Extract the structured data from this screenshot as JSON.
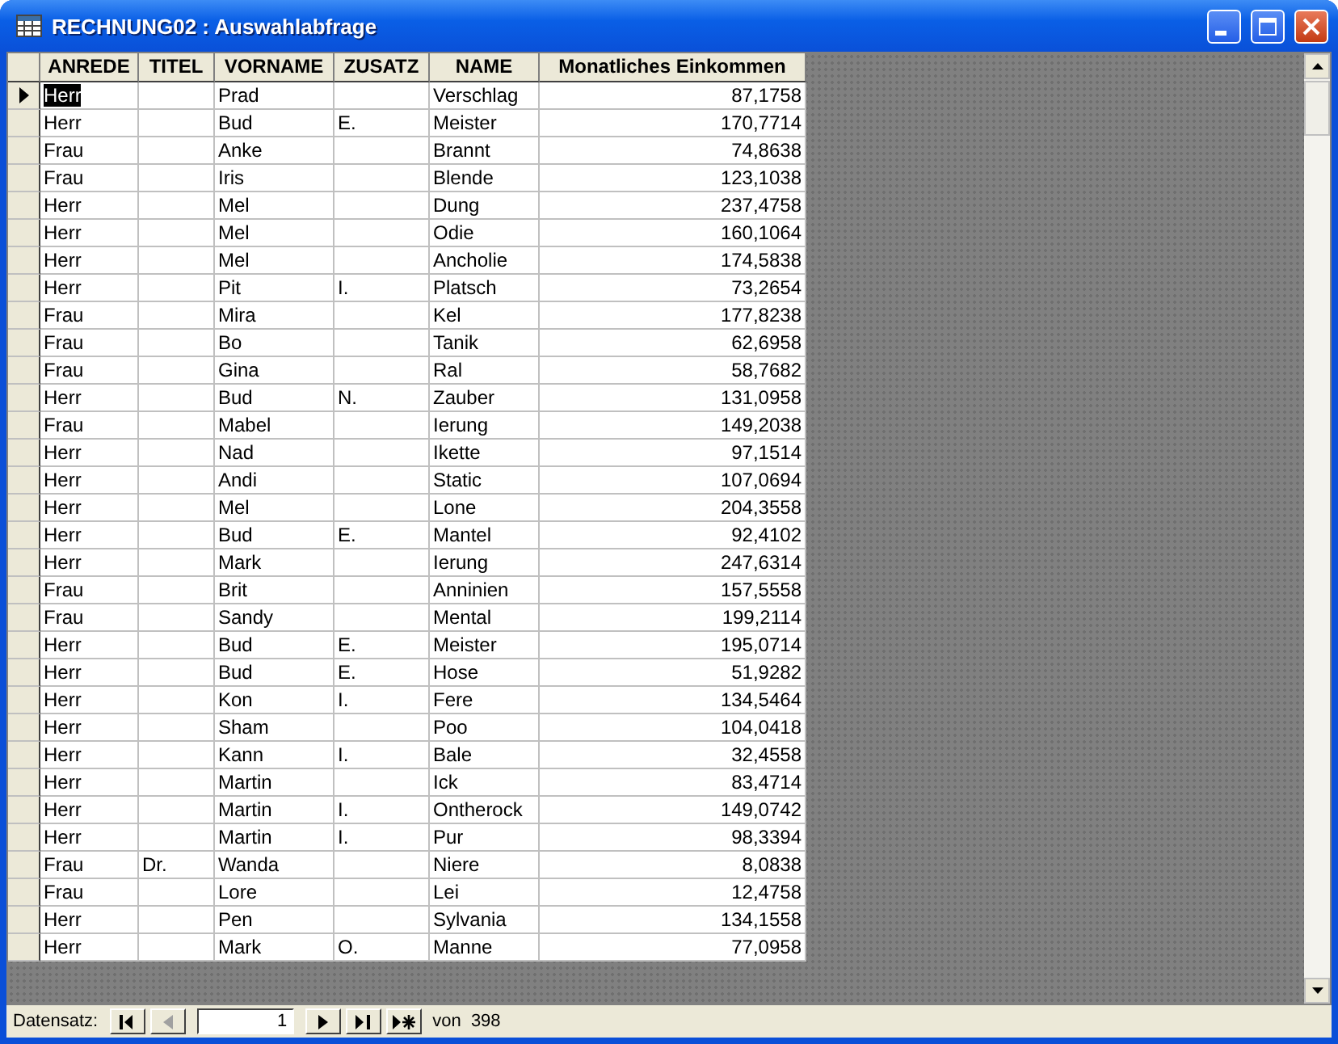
{
  "window": {
    "title": "RECHNUNG02 : Auswahlabfrage"
  },
  "table": {
    "columns": [
      {
        "label": "ANREDE",
        "kind": "text"
      },
      {
        "label": "TITEL",
        "kind": "text"
      },
      {
        "label": "VORNAME",
        "kind": "text"
      },
      {
        "label": "ZUSATZ",
        "kind": "text"
      },
      {
        "label": "NAME",
        "kind": "text"
      },
      {
        "label": "Monatliches Einkommen",
        "kind": "number"
      }
    ],
    "rows": [
      {
        "selected": true,
        "cells": [
          "Herr",
          null,
          "Prad",
          null,
          "Verschlag",
          "87,1758"
        ]
      },
      {
        "selected": false,
        "cells": [
          "Herr",
          null,
          "Bud",
          "E.",
          "Meister",
          "170,7714"
        ]
      },
      {
        "selected": false,
        "cells": [
          "Frau",
          null,
          "Anke",
          null,
          "Brannt",
          "74,8638"
        ]
      },
      {
        "selected": false,
        "cells": [
          "Frau",
          null,
          "Iris",
          null,
          "Blende",
          "123,1038"
        ]
      },
      {
        "selected": false,
        "cells": [
          "Herr",
          null,
          "Mel",
          null,
          "Dung",
          "237,4758"
        ]
      },
      {
        "selected": false,
        "cells": [
          "Herr",
          null,
          "Mel",
          null,
          "Odie",
          "160,1064"
        ]
      },
      {
        "selected": false,
        "cells": [
          "Herr",
          null,
          "Mel",
          null,
          "Ancholie",
          "174,5838"
        ]
      },
      {
        "selected": false,
        "cells": [
          "Herr",
          null,
          "Pit",
          "I.",
          "Platsch",
          "73,2654"
        ]
      },
      {
        "selected": false,
        "cells": [
          "Frau",
          null,
          "Mira",
          null,
          "Kel",
          "177,8238"
        ]
      },
      {
        "selected": false,
        "cells": [
          "Frau",
          null,
          "Bo",
          null,
          "Tanik",
          "62,6958"
        ]
      },
      {
        "selected": false,
        "cells": [
          "Frau",
          null,
          "Gina",
          null,
          "Ral",
          "58,7682"
        ]
      },
      {
        "selected": false,
        "cells": [
          "Herr",
          null,
          "Bud",
          "N.",
          "Zauber",
          "131,0958"
        ]
      },
      {
        "selected": false,
        "cells": [
          "Frau",
          null,
          "Mabel",
          null,
          "Ierung",
          "149,2038"
        ]
      },
      {
        "selected": false,
        "cells": [
          "Herr",
          null,
          "Nad",
          null,
          "Ikette",
          "97,1514"
        ]
      },
      {
        "selected": false,
        "cells": [
          "Herr",
          null,
          "Andi",
          null,
          "Static",
          "107,0694"
        ]
      },
      {
        "selected": false,
        "cells": [
          "Herr",
          null,
          "Mel",
          null,
          "Lone",
          "204,3558"
        ]
      },
      {
        "selected": false,
        "cells": [
          "Herr",
          null,
          "Bud",
          "E.",
          "Mantel",
          "92,4102"
        ]
      },
      {
        "selected": false,
        "cells": [
          "Herr",
          null,
          "Mark",
          null,
          "Ierung",
          "247,6314"
        ]
      },
      {
        "selected": false,
        "cells": [
          "Frau",
          null,
          "Brit",
          null,
          "Anninien",
          "157,5558"
        ]
      },
      {
        "selected": false,
        "cells": [
          "Frau",
          null,
          "Sandy",
          null,
          "Mental",
          "199,2114"
        ]
      },
      {
        "selected": false,
        "cells": [
          "Herr",
          null,
          "Bud",
          "E.",
          "Meister",
          "195,0714"
        ]
      },
      {
        "selected": false,
        "cells": [
          "Herr",
          null,
          "Bud",
          "E.",
          "Hose",
          "51,9282"
        ]
      },
      {
        "selected": false,
        "cells": [
          "Herr",
          null,
          "Kon",
          "I.",
          "Fere",
          "134,5464"
        ]
      },
      {
        "selected": false,
        "cells": [
          "Herr",
          null,
          "Sham",
          null,
          "Poo",
          "104,0418"
        ]
      },
      {
        "selected": false,
        "cells": [
          "Herr",
          null,
          "Kann",
          "I.",
          "Bale",
          "32,4558"
        ]
      },
      {
        "selected": false,
        "cells": [
          "Herr",
          null,
          "Martin",
          null,
          "Ick",
          "83,4714"
        ]
      },
      {
        "selected": false,
        "cells": [
          "Herr",
          null,
          "Martin",
          "I.",
          "Ontherock",
          "149,0742"
        ]
      },
      {
        "selected": false,
        "cells": [
          "Herr",
          null,
          "Martin",
          "I.",
          "Pur",
          "98,3394"
        ]
      },
      {
        "selected": false,
        "cells": [
          "Frau",
          "Dr.",
          "Wanda",
          null,
          "Niere",
          "8,0838"
        ]
      },
      {
        "selected": false,
        "cells": [
          "Frau",
          null,
          "Lore",
          null,
          "Lei",
          "12,4758"
        ]
      },
      {
        "selected": false,
        "cells": [
          "Herr",
          null,
          "Pen",
          null,
          "Sylvania",
          "134,1558"
        ]
      },
      {
        "selected": false,
        "cells": [
          "Herr",
          null,
          "Mark",
          "O.",
          "Manne",
          "77,0958"
        ]
      }
    ]
  },
  "navigator": {
    "label": "Datensatz:",
    "buttons": [
      {
        "kind": "first",
        "disabled": false
      },
      {
        "kind": "prev",
        "disabled": true
      }
    ],
    "record": "1",
    "buttons_after": [
      {
        "kind": "next",
        "disabled": false
      },
      {
        "kind": "last",
        "disabled": false
      },
      {
        "kind": "new",
        "disabled": false
      }
    ],
    "total": "von  398"
  }
}
